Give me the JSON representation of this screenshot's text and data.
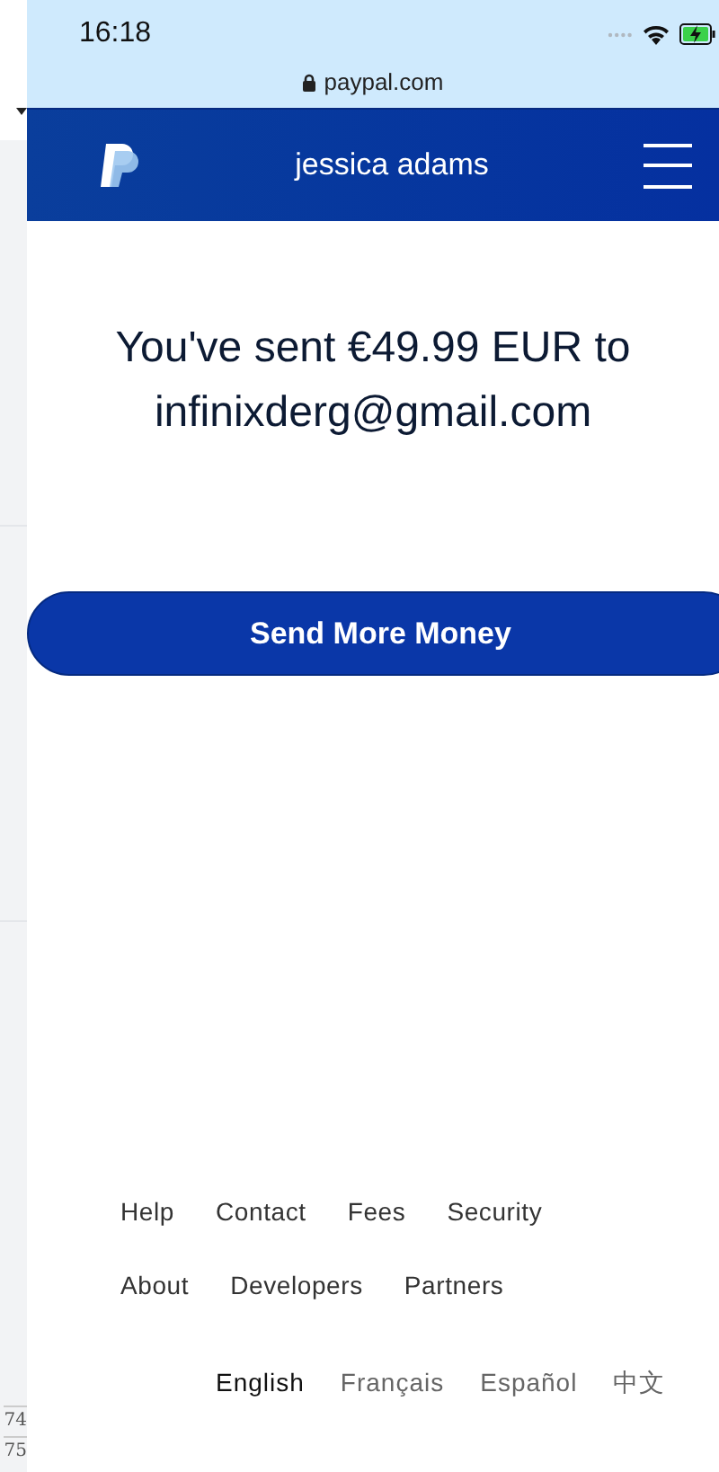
{
  "side_strip": {
    "row_numbers": [
      "74",
      "75"
    ]
  },
  "status_bar": {
    "time": "16:18"
  },
  "address_bar": {
    "url": "paypal.com"
  },
  "header": {
    "user_name": "jessica adams"
  },
  "message": {
    "text": "You've sent €49.99 EUR to infinixderg@gmail.com"
  },
  "primary_button": {
    "label": "Send More Money"
  },
  "footer": {
    "link_rows": [
      [
        "Help",
        "Contact",
        "Fees",
        "Security"
      ],
      [
        "About",
        "Developers",
        "Partners"
      ]
    ],
    "languages": [
      {
        "label": "English",
        "selected": true
      },
      {
        "label": "Français",
        "selected": false
      },
      {
        "label": "Español",
        "selected": false
      },
      {
        "label": "中文",
        "selected": false
      }
    ]
  }
}
